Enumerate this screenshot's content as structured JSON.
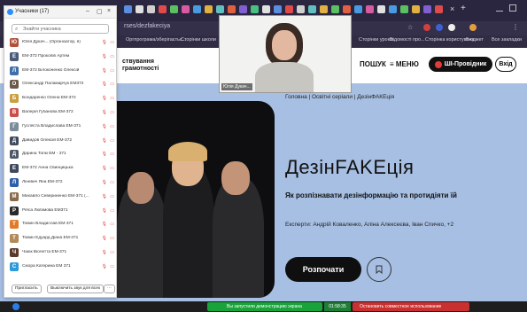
{
  "browser": {
    "url_partial": "rses/dezfakeciya",
    "tab_close": "×",
    "tab_new": "+",
    "bookmarks": [
      "Оргпрограма/зберігаєтьс...",
      "Сторінки школи",
      "Сторінки уроків",
      "Відомості про...",
      "Сторінка користувача",
      "Бюджет",
      "Все закладки"
    ]
  },
  "site": {
    "logo_line1": "ствування",
    "logo_line2": "грамотності",
    "nav": {
      "search": "ПОШУК",
      "menu": "≡ МЕНЮ",
      "guide": "ШІ-Провідник",
      "login": "Вхід"
    },
    "breadcrumb": "Головна  |  Освітні серіали  |  ДезінФАКЕція",
    "title": "ДезінFAKEція",
    "subtitle": "Як розпізнавати дезінформацію та протидіяти їй",
    "experts": "Експерти: Андрій Коваленко, Аліна Алексеєва, Іван Спичко, +2",
    "start_button": "Розпочати",
    "colors": {
      "hero_bg": "#a7bfe3",
      "poster_bg": "#0e0e10"
    }
  },
  "participants": {
    "title": "Учасники (17)",
    "search_placeholder": "Знайти учасника",
    "rows": [
      {
        "name": "Юлія Дукач... (Організатор, я)",
        "initial": "Ю",
        "color": "#b0523b"
      },
      {
        "name": "ЕМ-372 Прокопів Артем",
        "initial": "Е",
        "color": "#4a5a7a"
      },
      {
        "name": "ЕМ-372 Білоконенко Олексій",
        "initial": "Л",
        "color": "#3f6ea8"
      },
      {
        "name": "Олександр Паламарчук ЕМ372",
        "initial": "О",
        "color": "#6b5a4a"
      },
      {
        "name": "Бондаренко Олена ЕМ-372",
        "initial": "Б",
        "color": "#c9a040"
      },
      {
        "name": "Валерія Губанова ЕМ-372",
        "initial": "В",
        "color": "#c9504a"
      },
      {
        "name": "Гусляста Владислава ЕМ-371",
        "initial": "Г",
        "color": "#7b8c9a"
      },
      {
        "name": "Давидов Олексій ЕМ-372",
        "initial": "Д",
        "color": "#3d4a5c"
      },
      {
        "name": "Дарина Топкі ЕМ - 371",
        "initial": "Д",
        "color": "#4d5866"
      },
      {
        "name": "ЕМ-372 Анна Свинцицька",
        "initial": "Е",
        "color": "#3d4a5c"
      },
      {
        "name": "Ліневич Яна ЕМ-372",
        "initial": "Л",
        "color": "#2f5fa8"
      },
      {
        "name": "Михайло Севериненко ЕМ-371 (...",
        "initial": "М",
        "color": "#8a6a4a"
      },
      {
        "name": "Реїса Любімова ЕМ371",
        "initial": "Р",
        "color": "#2a2a2a"
      },
      {
        "name": "Томин Владислав ЕМ-371",
        "initial": "Т",
        "color": "#e07b2a"
      },
      {
        "name": "Томин Едуард  Діана ЕМ-371",
        "initial": "Т",
        "color": "#b08a5a"
      },
      {
        "name": "Чаюк Віолетта ЕМ-371",
        "initial": "Ч",
        "color": "#5a3a2a"
      },
      {
        "name": "Сікора Катерина ЕМ 371",
        "initial": "С",
        "color": "#2f9ad8"
      }
    ],
    "invite_button": "Пригласить",
    "mute_all_button": "Выключить звук для всех",
    "more_button": "···"
  },
  "video": {
    "name": "Юлія Дукач..."
  },
  "sharebar": {
    "sharing_text": "Вы запустили демонстрацию экрана",
    "timer": "01:58:35",
    "stop_text": "Остановить совместное использование"
  }
}
